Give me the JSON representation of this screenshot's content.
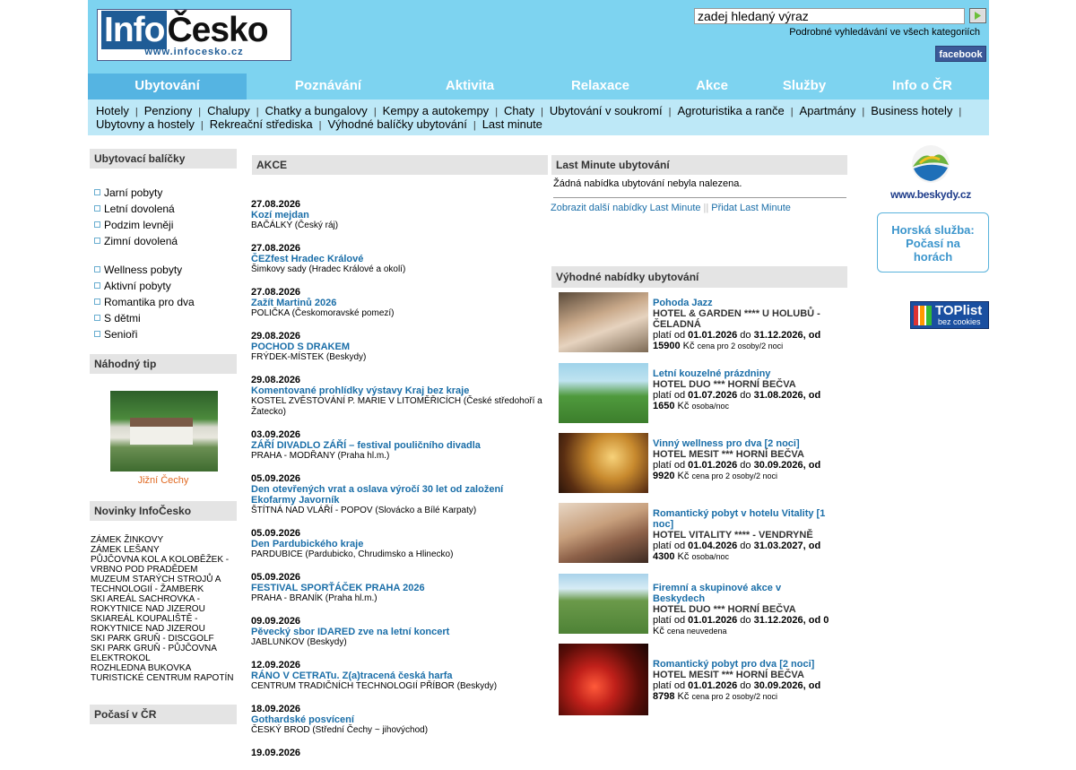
{
  "header": {
    "logo_part1": "Info",
    "logo_part2": "Česko",
    "logo_url": "www.infocesko.cz",
    "search_placeholder": "zadej hledaný výraz",
    "advanced_search": "Podrobné vyhledávání ve všech kategoriích",
    "facebook": "facebook"
  },
  "nav": {
    "tabs": [
      "Ubytování",
      "Poznávání",
      "Aktivita",
      "Relaxace",
      "Akce",
      "Služby",
      "Info o ČR"
    ],
    "active": "Ubytování",
    "active_color": "#55b4e2"
  },
  "subnav": {
    "row1": [
      "Hotely",
      "Penziony",
      "Chalupy",
      "Chatky a bungalovy",
      "Kempy a autokempy",
      "Chaty",
      "Ubytování v soukromí",
      "Agroturistika a ranče",
      "Apartmány",
      "Business hotely"
    ],
    "row2": [
      "Ubytovny a hostely",
      "Rekreační střediska",
      "Výhodné balíčky ubytování",
      "Last minute"
    ]
  },
  "left": {
    "packages_heading": "Ubytovací balíčky",
    "packages_group1": [
      "Jarní pobyty",
      "Letní dovolená",
      "Podzim levněji",
      "Zimní dovolená"
    ],
    "packages_group2": [
      "Wellness pobyty",
      "Aktivní pobyty",
      "Romantika pro dva",
      "S dětmi",
      "Senioři"
    ],
    "tip_heading": "Náhodný tip",
    "tip_caption": "Jižní Čechy",
    "news_heading": "Novinky InfoČesko",
    "news": [
      "ZÁMEK ŽINKOVY",
      "ZÁMEK LEŠANY",
      "PŮJČOVNA KOL A KOLOBĚŽEK - VRBNO POD PRADĚDEM",
      "MUZEUM STARÝCH STROJŮ A TECHNOLOGIÍ - ŽAMBERK",
      "SKI AREÁL SACHROVKA - ROKYTNICE NAD JIZEROU",
      "SKIAREÁL KOUPALIŠTĚ - ROKYTNICE NAD JIZEROU",
      "SKI PARK GRUŇ - DISCGOLF",
      "SKI PARK GRUŇ - PŮJČOVNA ELEKTROKOL",
      "ROZHLEDNA BUKOVKA",
      "TURISTICKÉ CENTRUM RAPOTÍN"
    ],
    "weather_heading": "Počasí v ČR"
  },
  "akce": {
    "heading": "AKCE",
    "events": [
      {
        "date": "27.08.2026",
        "title": "Kozí mejdan",
        "location": "BAČÁLKY (Český ráj)"
      },
      {
        "date": "27.08.2026",
        "title": "ČEZfest Hradec Králové",
        "location": "Šimkovy sady (Hradec Králové a okolí)"
      },
      {
        "date": "27.08.2026",
        "title": "Zažít Martinů 2026",
        "location": "POLIČKA (Českomoravské pomezí)"
      },
      {
        "date": "29.08.2026",
        "title": "POCHOD S DRAKEM",
        "location": "FRÝDEK-MÍSTEK (Beskydy)"
      },
      {
        "date": "29.08.2026",
        "title": "Komentované prohlídky výstavy Kraj bez kraje",
        "location": "KOSTEL ZVĚSTOVÁNÍ P. MARIE V LITOMĚŘICÍCH (České středohoří a Žatecko)"
      },
      {
        "date": "03.09.2026",
        "title": "ZÁŘÍ DIVADLO ZÁŘÍ – festival pouličního divadla",
        "location": "PRAHA - MODŘANY (Praha hl.m.)"
      },
      {
        "date": "05.09.2026",
        "title": "Den otevřených vrat a oslava výročí 30 let od založení Ekofarmy Javorník",
        "location": "ŠTÍTNÁ NAD VLÁŘÍ - POPOV (Slovácko a Bílé Karpaty)"
      },
      {
        "date": "05.09.2026",
        "title": "Den Pardubického kraje",
        "location": "PARDUBICE (Pardubicko, Chrudimsko a Hlinecko)"
      },
      {
        "date": "05.09.2026",
        "title": "FESTIVAL SPORŤÁČEK PRAHA 2026",
        "location": "PRAHA - BRANÍK (Praha hl.m.)"
      },
      {
        "date": "09.09.2026",
        "title": "Pěvecký sbor IDARED zve na letní koncert",
        "location": "JABLUNKOV (Beskydy)"
      },
      {
        "date": "12.09.2026",
        "title": "RÁNO V CETRATu. Z(a)tracená česká harfa",
        "location": "CENTRUM TRADIČNÍCH TECHNOLOGIÍ PŘÍBOR (Beskydy)"
      },
      {
        "date": "18.09.2026",
        "title": "Gothardské posvícení",
        "location": "ČESKÝ BROD (Střední Čechy ~ jihovýchod)"
      },
      {
        "date": "19.09.2026",
        "title": "",
        "location": ""
      }
    ]
  },
  "last_minute": {
    "heading": "Last Minute ubytování",
    "none_text": "Žádná nabídka ubytování nebyla nalezena.",
    "more_link": "Zobrazit další nabídky Last Minute",
    "separator": "||",
    "add_link": "Přidat Last Minute"
  },
  "deals": {
    "heading": "Výhodné nabídky ubytování",
    "items": [
      {
        "title": "Pohoda Jazz",
        "hotel": "HOTEL & GARDEN **** U HOLUBŮ - ČELADNÁ",
        "valid_prefix": "platí od",
        "from": "01.01.2026",
        "to_word": "do",
        "to": "31.12.2026",
        "price_prefix": ", od",
        "price": "15900",
        "currency": "Kč",
        "note": "cena pro 2 osoby/2 noci"
      },
      {
        "title": "Letní kouzelné prázdniny",
        "hotel": "HOTEL DUO *** HORNÍ BEČVA",
        "valid_prefix": "platí od",
        "from": "01.07.2026",
        "to_word": "do",
        "to": "31.08.2026",
        "price_prefix": ", od",
        "price": "1650",
        "currency": "Kč",
        "note": "osoba/noc"
      },
      {
        "title": "Vinný wellness pro dva [2 noci]",
        "hotel": "HOTEL MESIT *** HORNÍ BEČVA",
        "valid_prefix": "platí od",
        "from": "01.01.2026",
        "to_word": "do",
        "to": "30.09.2026",
        "price_prefix": ", od",
        "price": "9920",
        "currency": "Kč",
        "note": "cena pro 2 osoby/2 noci"
      },
      {
        "title": "Romantický pobyt v hotelu Vitality [1 noc]",
        "hotel": "HOTEL VITALITY **** - VENDRYNĚ",
        "valid_prefix": "platí od",
        "from": "01.04.2026",
        "to_word": "do",
        "to": "31.03.2027",
        "price_prefix": ", od",
        "price": "4300",
        "currency": "Kč",
        "note": "osoba/noc"
      },
      {
        "title": "Firemní a skupinové akce v Beskydech",
        "hotel": "HOTEL DUO *** HORNÍ BEČVA",
        "valid_prefix": "platí od",
        "from": "01.01.2026",
        "to_word": "do",
        "to": "31.12.2026",
        "price_prefix": ", od",
        "price": "0",
        "currency": "Kč",
        "note": "cena neuvedena"
      },
      {
        "title": "Romantický pobyt pro dva [2 noci]",
        "hotel": "HOTEL MESIT *** HORNÍ BEČVA",
        "valid_prefix": "platí od",
        "from": "01.01.2026",
        "to_word": "do",
        "to": "30.09.2026",
        "price_prefix": ", od",
        "price": "8798",
        "currency": "Kč",
        "note": "cena pro 2 osoby/2 noci"
      }
    ]
  },
  "right": {
    "beskydy_url": "www.beskydy.cz",
    "horska_line1": "Horská služba:",
    "horska_line2": "Počasí na",
    "horska_line3": "horách",
    "toplist_title": "TOPlist",
    "toplist_sub": "bez cookies"
  }
}
